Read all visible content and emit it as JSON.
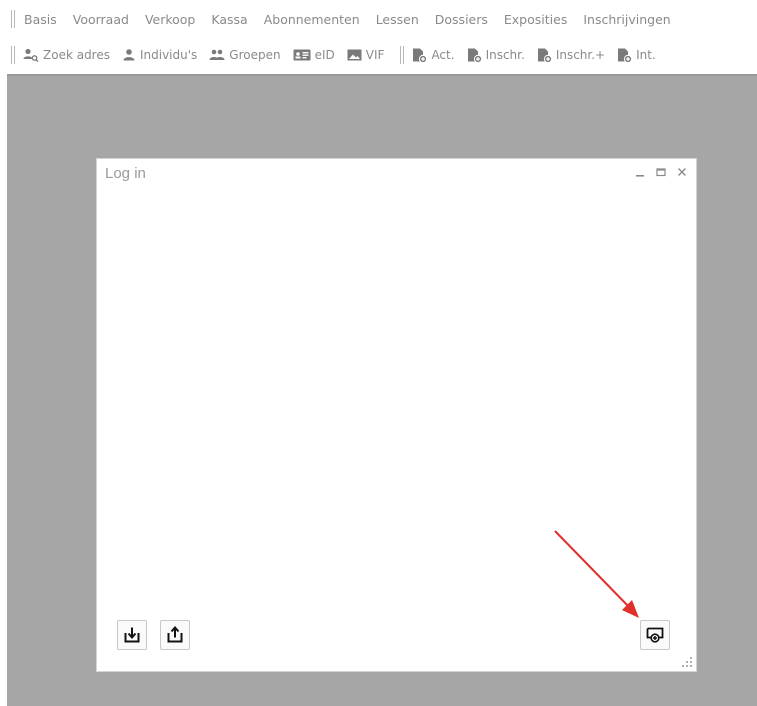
{
  "menu": {
    "items": [
      {
        "label": "Basis"
      },
      {
        "label": "Voorraad"
      },
      {
        "label": "Verkoop"
      },
      {
        "label": "Kassa"
      },
      {
        "label": "Abonnementen"
      },
      {
        "label": "Lessen"
      },
      {
        "label": "Dossiers"
      },
      {
        "label": "Exposities"
      },
      {
        "label": "Inschrijvingen"
      }
    ]
  },
  "toolbar": {
    "group1": [
      {
        "label": "Zoek adres",
        "icon": "person-search-icon"
      },
      {
        "label": "Individu's",
        "icon": "person-icon"
      },
      {
        "label": "Groepen",
        "icon": "group-icon"
      },
      {
        "label": "eID",
        "icon": "id-card-icon"
      },
      {
        "label": "VIF",
        "icon": "image-icon"
      }
    ],
    "group2": [
      {
        "label": "Act.",
        "icon": "document-add-icon"
      },
      {
        "label": "Inschr.",
        "icon": "document-add-icon"
      },
      {
        "label": "Inschr.+",
        "icon": "document-add-icon"
      },
      {
        "label": "Int.",
        "icon": "document-add-icon"
      }
    ]
  },
  "dialog": {
    "title": "Log in",
    "controls": [
      "minimize-icon",
      "maximize-icon",
      "close-icon"
    ],
    "buttons": {
      "download": "download-icon",
      "upload": "upload-icon",
      "add_window": "add-window-icon"
    }
  },
  "colors": {
    "workspace": "#a6a6a6",
    "menu_text": "#8a8a8a",
    "annotation_arrow": "#e0302b"
  }
}
